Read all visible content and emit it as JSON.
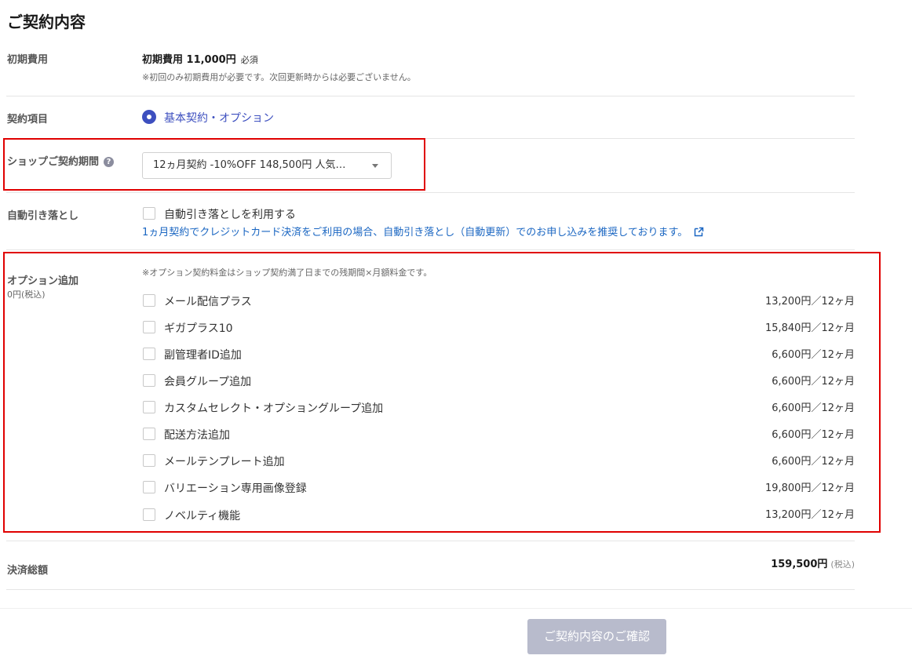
{
  "page_title": "ご契約内容",
  "initial_fee": {
    "label": "初期費用",
    "amount": "初期費用 11,000円",
    "required": "必須",
    "note": "※初回のみ初期費用が必要です。次回更新時からは必要ございません。"
  },
  "contract_item": {
    "label": "契約項目",
    "option_label": "基本契約・オプション",
    "selected": true
  },
  "contract_period": {
    "label": "ショップご契約期間",
    "help_icon": "question-circle-icon",
    "selected_value": "12ヵ月契約 -10%OFF 148,500円 人気…"
  },
  "auto_debit": {
    "label": "自動引き落とし",
    "checkbox_label": "自動引き落としを利用する",
    "checked": false,
    "link_text": "1ヵ月契約でクレジットカード決済をご利用の場合、自動引き落とし（自動更新）でのお申し込みを推奨しております。",
    "link_icon": "external-link-icon"
  },
  "options": {
    "label": "オプション追加",
    "sub_label": "0円(税込)",
    "note": "※オプション契約料金はショップ契約満了日までの残期間×月額料金です。",
    "items": [
      {
        "name": "メール配信プラス",
        "price": "13,200円／12ヶ月",
        "checked": false
      },
      {
        "name": "ギガプラス10",
        "price": "15,840円／12ヶ月",
        "checked": false
      },
      {
        "name": "副管理者ID追加",
        "price": "6,600円／12ヶ月",
        "checked": false
      },
      {
        "name": "会員グループ追加",
        "price": "6,600円／12ヶ月",
        "checked": false
      },
      {
        "name": "カスタムセレクト・オプショングループ追加",
        "price": "6,600円／12ヶ月",
        "checked": false
      },
      {
        "name": "配送方法追加",
        "price": "6,600円／12ヶ月",
        "checked": false
      },
      {
        "name": "メールテンプレート追加",
        "price": "6,600円／12ヶ月",
        "checked": false
      },
      {
        "name": "バリエーション専用画像登録",
        "price": "19,800円／12ヶ月",
        "checked": false
      },
      {
        "name": "ノベルティ機能",
        "price": "13,200円／12ヶ月",
        "checked": false
      }
    ]
  },
  "total": {
    "label": "決済総額",
    "amount": "159,500円",
    "tax": "(税込)"
  },
  "confirm_button": "ご契約内容のご確認",
  "colors": {
    "accent": "#3d4fbf",
    "link": "#1a66c2",
    "highlight_border": "#e00000",
    "button_disabled": "#b8bbcc"
  }
}
